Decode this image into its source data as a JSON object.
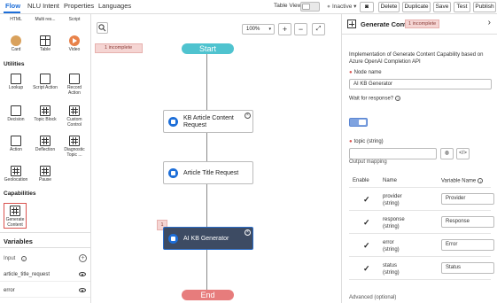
{
  "topbar": {
    "tabs": [
      "Flow",
      "NLU Intent",
      "Properties",
      "Languages"
    ],
    "table_view_label": "Table View",
    "status_label": "Inactive",
    "buttons": {
      "delete": "Delete",
      "duplicate": "Duplicate",
      "save": "Save",
      "test": "Test",
      "publish": "Publish"
    }
  },
  "palette": {
    "top_partial": [
      "HTML",
      "Multi res...",
      "Script"
    ],
    "row_media": [
      "Card",
      "Table",
      "Video"
    ],
    "utilities_title": "Utilities",
    "utilities": [
      "Lookup",
      "Script Action",
      "Record Action",
      "Decision",
      "Topic Block",
      "Custom Control",
      "Action",
      "Deflection",
      "Diagnostic Topic ...",
      "Geolocation",
      "Pause"
    ],
    "capabilities_title": "Capabilities",
    "capabilities": [
      "Generate Content"
    ]
  },
  "variables": {
    "title": "Variables",
    "input_label": "Input",
    "items": [
      "article_title_request",
      "error"
    ]
  },
  "canvas": {
    "zoom": "100%",
    "incomplete_badge": "1 incomplete",
    "start_label": "Start",
    "end_label": "End",
    "nodes": [
      "KB Article Content Request",
      "Article Title Request",
      "AI KB Generator"
    ],
    "node_error_count": "1"
  },
  "panel": {
    "title": "Generate Content",
    "badge": "1 incomplete",
    "description": "Implementation of Generate Content Capability based on Azure OpenAI Completion API",
    "node_name_label": "Node name",
    "node_name_value": "AI KB Generator",
    "wait_label": "Wait for response?",
    "topic_label": "topic",
    "topic_type": "(string)",
    "output_mapping_title": "Output mapping",
    "columns": {
      "enable": "Enable",
      "name": "Name",
      "variable": "Variable Name"
    },
    "rows": [
      {
        "name": "provider",
        "type": "(string)",
        "value": "Provider"
      },
      {
        "name": "response",
        "type": "(string)",
        "value": "Response"
      },
      {
        "name": "error",
        "type": "(string)",
        "value": "Error"
      },
      {
        "name": "status",
        "type": "(string)",
        "value": "Status"
      }
    ],
    "advanced_label": "Advanced (optional)"
  },
  "colors": {
    "accent": "#1d6ed8",
    "start_pill": "#4fc3cf",
    "end_pill": "#e77c7c",
    "selected_node": "#3d4b63",
    "error_badge": "#f5d5d3"
  }
}
